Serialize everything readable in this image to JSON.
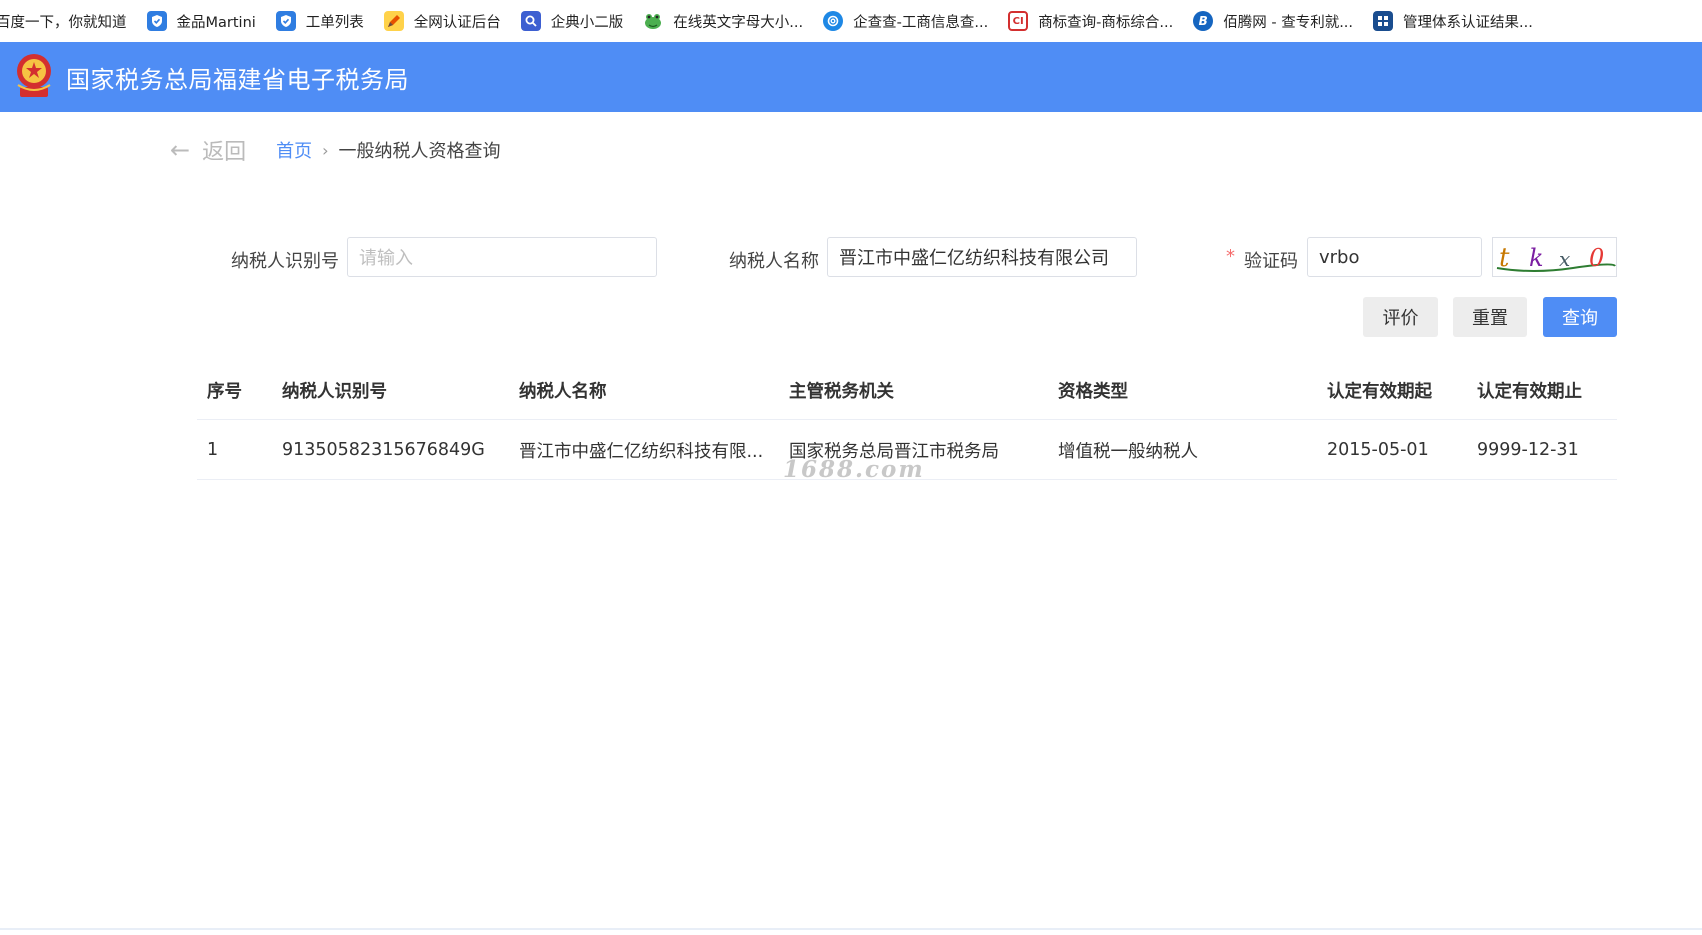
{
  "bookmarks": [
    {
      "label": "百度一下，你就知道",
      "icon": "baidu-icon",
      "color": "#ffffff"
    },
    {
      "label": "金品Martini",
      "icon": "shield-icon",
      "color": "#2f7de1"
    },
    {
      "label": "工单列表",
      "icon": "shield-icon",
      "color": "#2f7de1"
    },
    {
      "label": "全网认证后台",
      "icon": "pencil-icon",
      "color": "#f0b400"
    },
    {
      "label": "企典小二版",
      "icon": "search-icon",
      "color": "#3d5fd1"
    },
    {
      "label": "在线英文字母大小...",
      "icon": "frog-icon",
      "color": "#3fa34d"
    },
    {
      "label": "企查查-工商信息查...",
      "icon": "qcc-icon",
      "color": "#1e88e5"
    },
    {
      "label": "商标查询-商标综合...",
      "icon": "trademark-icon",
      "color": "#d32f2f"
    },
    {
      "label": "佰腾网 - 查专利就...",
      "icon": "b-icon",
      "color": "#1565c0"
    },
    {
      "label": "管理体系认证结果...",
      "icon": "grid-icon",
      "color": "#1a4d8f"
    }
  ],
  "header": {
    "title": "国家税务总局福建省电子税务局",
    "bg_color": "#4f8df5"
  },
  "breadcrumb": {
    "back_arrow": "←",
    "back_label": "返回",
    "home": "首页",
    "separator": "›",
    "current": "一般纳税人资格查询"
  },
  "form": {
    "taxpayer_id_label": "纳税人识别号",
    "taxpayer_id_placeholder": "请输入",
    "taxpayer_id_value": "",
    "taxpayer_name_label": "纳税人名称",
    "taxpayer_name_value": "晋江市中盛仁亿纺织科技有限公司",
    "required_mark": "*",
    "captcha_label": "验证码",
    "captcha_value": "vrbo",
    "captcha_image_chars": "t k x 0"
  },
  "buttons": {
    "rate": "评价",
    "reset": "重置",
    "query": "查询"
  },
  "table": {
    "headers": [
      "序号",
      "纳税人识别号",
      "纳税人名称",
      "主管税务机关",
      "资格类型",
      "认定有效期起",
      "认定有效期止"
    ],
    "rows": [
      [
        "1",
        "91350582315676849G",
        "晋江市中盛仁亿纺织科技有限...",
        "国家税务总局晋江市税务局",
        "增值税一般纳税人",
        "2015-05-01",
        "9999-12-31"
      ]
    ]
  },
  "watermark": "1688.com"
}
